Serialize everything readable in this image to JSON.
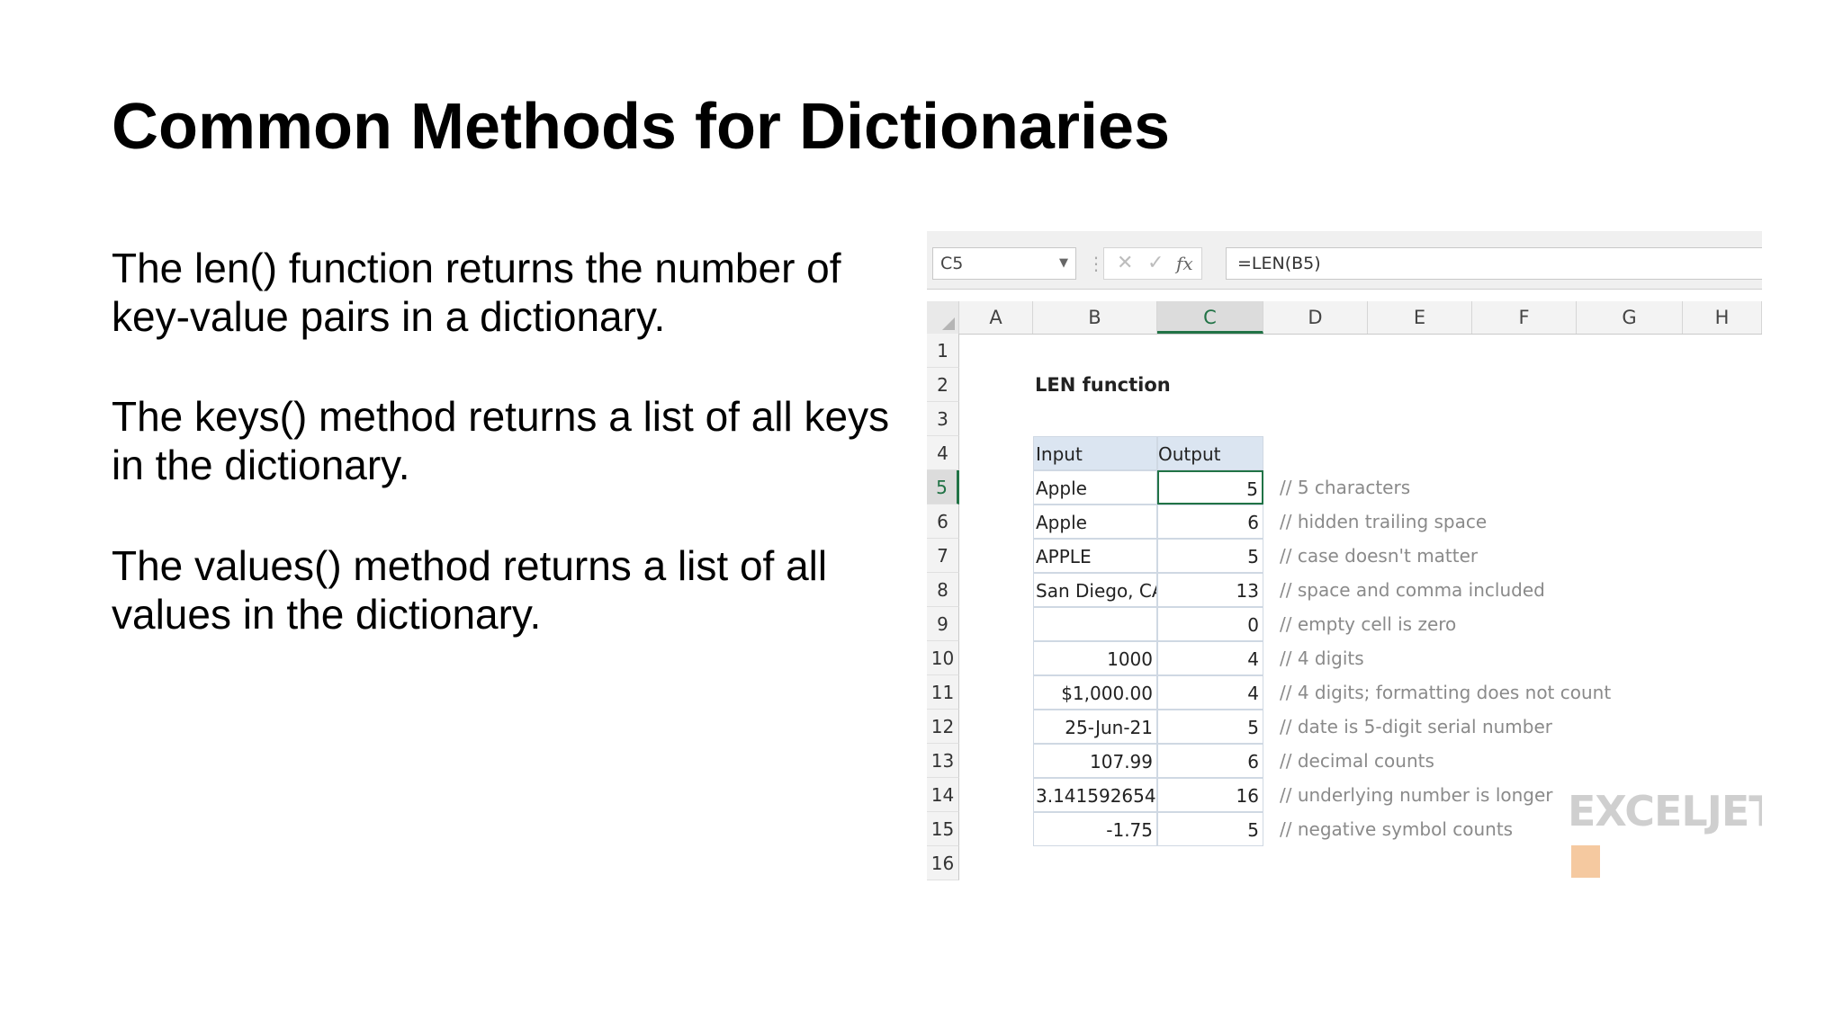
{
  "slide": {
    "title": "Common Methods for Dictionaries",
    "paragraphs": [
      "The len() function returns the number of key-value pairs in a dictionary.",
      "The keys() method returns a list of all keys in the dictionary.",
      "The values() method returns a list of all values in the dictionary."
    ]
  },
  "spreadsheet": {
    "name_box": "C5",
    "formula": "=LEN(B5)",
    "fx_label": "fx",
    "columns": [
      "A",
      "B",
      "C",
      "D",
      "E",
      "F",
      "G",
      "H"
    ],
    "active_column": "C",
    "rows": [
      "1",
      "2",
      "3",
      "4",
      "5",
      "6",
      "7",
      "8",
      "9",
      "10",
      "11",
      "12",
      "13",
      "14",
      "15",
      "16"
    ],
    "active_row": "5",
    "sheet_title": "LEN function",
    "table_headers": {
      "input": "Input",
      "output": "Output"
    },
    "table_rows": [
      {
        "input": "Apple",
        "output": "5",
        "comment": "// 5 characters",
        "numeric": false
      },
      {
        "input": "Apple",
        "output": "6",
        "comment": "// hidden trailing space",
        "numeric": false
      },
      {
        "input": "APPLE",
        "output": "5",
        "comment": "// case doesn't matter",
        "numeric": false
      },
      {
        "input": "San Diego, CA",
        "output": "13",
        "comment": "// space and comma included",
        "numeric": false
      },
      {
        "input": "",
        "output": "0",
        "comment": "// empty cell is zero",
        "numeric": false
      },
      {
        "input": "1000",
        "output": "4",
        "comment": "// 4 digits",
        "numeric": true
      },
      {
        "input": "$1,000.00",
        "output": "4",
        "comment": "// 4 digits; formatting does not count",
        "numeric": true
      },
      {
        "input": "25-Jun-21",
        "output": "5",
        "comment": "// date is 5-digit serial number",
        "numeric": true
      },
      {
        "input": "107.99",
        "output": "6",
        "comment": "// decimal counts",
        "numeric": true
      },
      {
        "input": "3.141592654",
        "output": "16",
        "comment": "// underlying number is longer",
        "numeric": true
      },
      {
        "input": "-1.75",
        "output": "5",
        "comment": "// negative symbol counts",
        "numeric": true
      }
    ],
    "watermark": "EXCELJET"
  }
}
